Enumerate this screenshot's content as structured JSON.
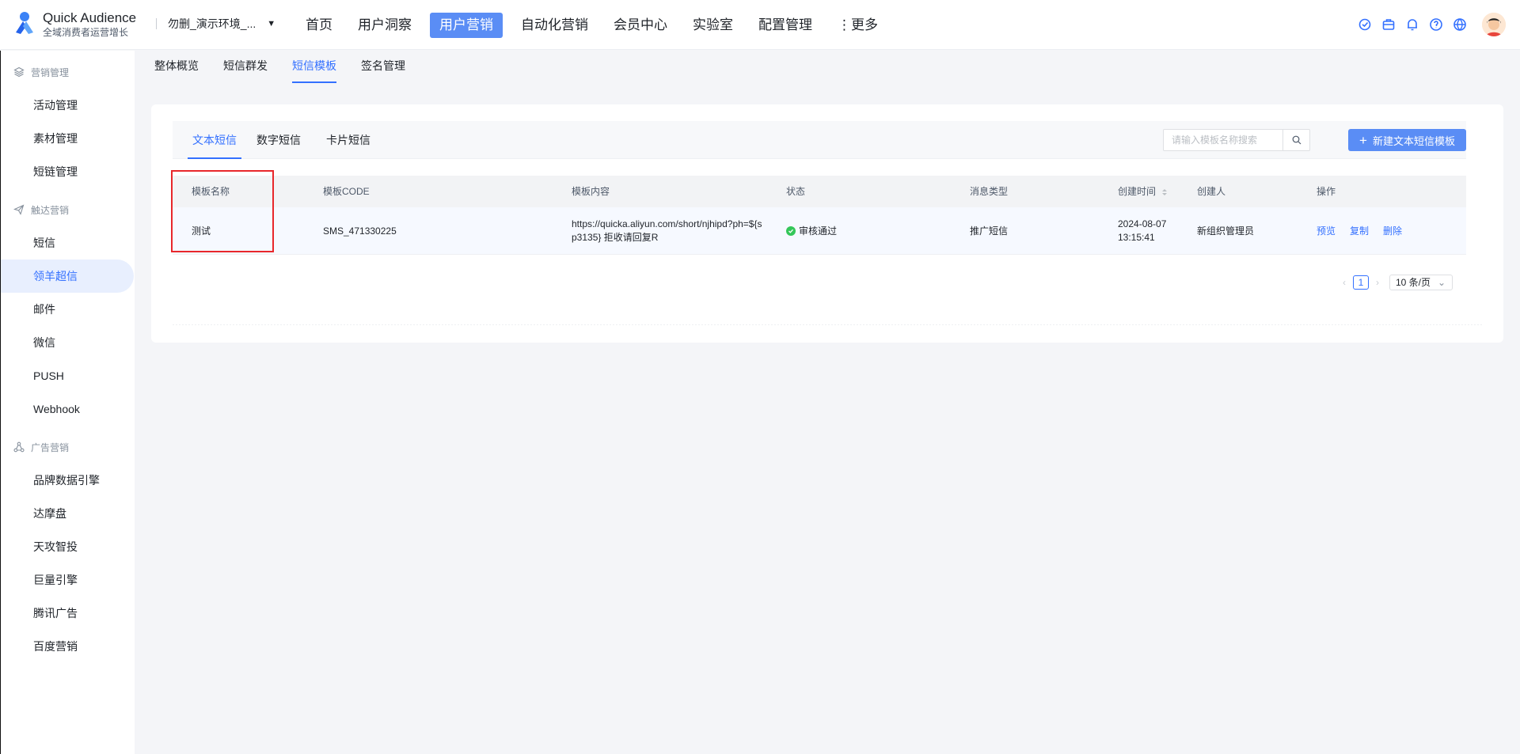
{
  "brand": {
    "name": "Quick Audience",
    "subtitle": "全域消费者运营增长"
  },
  "env_select": {
    "value": "勿删_演示环境_..."
  },
  "top_nav": {
    "items": [
      {
        "label": "首页"
      },
      {
        "label": "用户洞察"
      },
      {
        "label": "用户营销",
        "active": true
      },
      {
        "label": "自动化营销"
      },
      {
        "label": "会员中心"
      },
      {
        "label": "实验室"
      },
      {
        "label": "配置管理"
      },
      {
        "label": "⋮更多"
      }
    ]
  },
  "top_icons": [
    "ai-assistant-icon",
    "briefcase-icon",
    "bell-icon",
    "help-icon",
    "globe-icon"
  ],
  "sidebar": {
    "groups": [
      {
        "label": "营销管理",
        "icon": "layers-icon",
        "items": [
          "活动管理",
          "素材管理",
          "短链管理"
        ]
      },
      {
        "label": "触达营销",
        "icon": "send-icon",
        "items": [
          "短信",
          "领羊超信",
          "邮件",
          "微信",
          "PUSH",
          "Webhook"
        ]
      },
      {
        "label": "广告营销",
        "icon": "share-icon",
        "items": [
          "品牌数据引擎",
          "达摩盘",
          "天攻智投",
          "巨量引擎",
          "腾讯广告",
          "百度营销"
        ]
      }
    ],
    "active_item": "领羊超信"
  },
  "sub_nav": {
    "items": [
      "整体概览",
      "短信群发",
      "短信模板",
      "签名管理"
    ],
    "active": "短信模板"
  },
  "inner_tabs": {
    "items": [
      "文本短信",
      "数字短信",
      "卡片短信"
    ],
    "active": "文本短信"
  },
  "search": {
    "placeholder": "请输入模板名称搜索",
    "value": ""
  },
  "new_button": {
    "label": "新建文本短信模板"
  },
  "table": {
    "columns": [
      "模板名称",
      "模板CODE",
      "模板内容",
      "状态",
      "消息类型",
      "创建时间",
      "创建人",
      "操作"
    ],
    "rows": [
      {
        "name": "测试",
        "code": "SMS_471330225",
        "content": "https://quicka.aliyun.com/short/njhipd?ph=${sp3135} 拒收请回复R",
        "status": "审核通过",
        "msg_type": "推广短信",
        "created_date": "2024-08-07",
        "created_time": "13:15:41",
        "creator": "新组织管理员",
        "actions": [
          "预览",
          "复制",
          "删除"
        ]
      }
    ]
  },
  "pagination": {
    "current_page": "1",
    "page_size": "10 条/页"
  },
  "colors": {
    "accent": "#3370ff",
    "primary_button": "#5a8df5",
    "status_success": "#34c759",
    "highlight": "#e8272b"
  }
}
